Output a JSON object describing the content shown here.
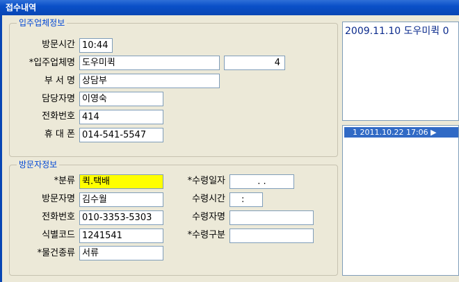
{
  "window": {
    "title": "접수내역"
  },
  "company_group": {
    "title": "입주업체정보",
    "visit_time_label": "방문시간",
    "visit_time_value": "10:44",
    "company_label": "*입주업체명",
    "company_value": "도우미퀵",
    "company_code": "4",
    "dept_label": "부 서 명",
    "dept_value": "상담부",
    "manager_label": "담당자명",
    "manager_value": "이영숙",
    "phone_label": "전화번호",
    "phone_value": "414",
    "mobile_label": "휴 대 폰",
    "mobile_value": "014-541-5547"
  },
  "visitor_group": {
    "title": "방문자정보",
    "category_label": "*분류",
    "category_value": "퀵.택배",
    "receive_date_label": "*수령일자",
    "receive_date_value": ".   .",
    "visitor_label": "방문자명",
    "visitor_value": "김수월",
    "receive_time_label": "수령시간",
    "receive_time_value": ":",
    "phone_label": "전화번호",
    "phone_value": "010-3353-5303",
    "receiver_label": "수령자명",
    "receiver_value": "",
    "id_code_label": "식별코드",
    "id_code_value": "1241541",
    "receive_type_label": "*수령구분",
    "receive_type_value": "",
    "item_type_label": "*물건종류",
    "item_type_value": "서류"
  },
  "memo_panel": {
    "text": "2009.11.10 도우미퀵 0"
  },
  "history_list": {
    "rows": [
      "1 2011.10.22 17:06 ▶"
    ]
  }
}
